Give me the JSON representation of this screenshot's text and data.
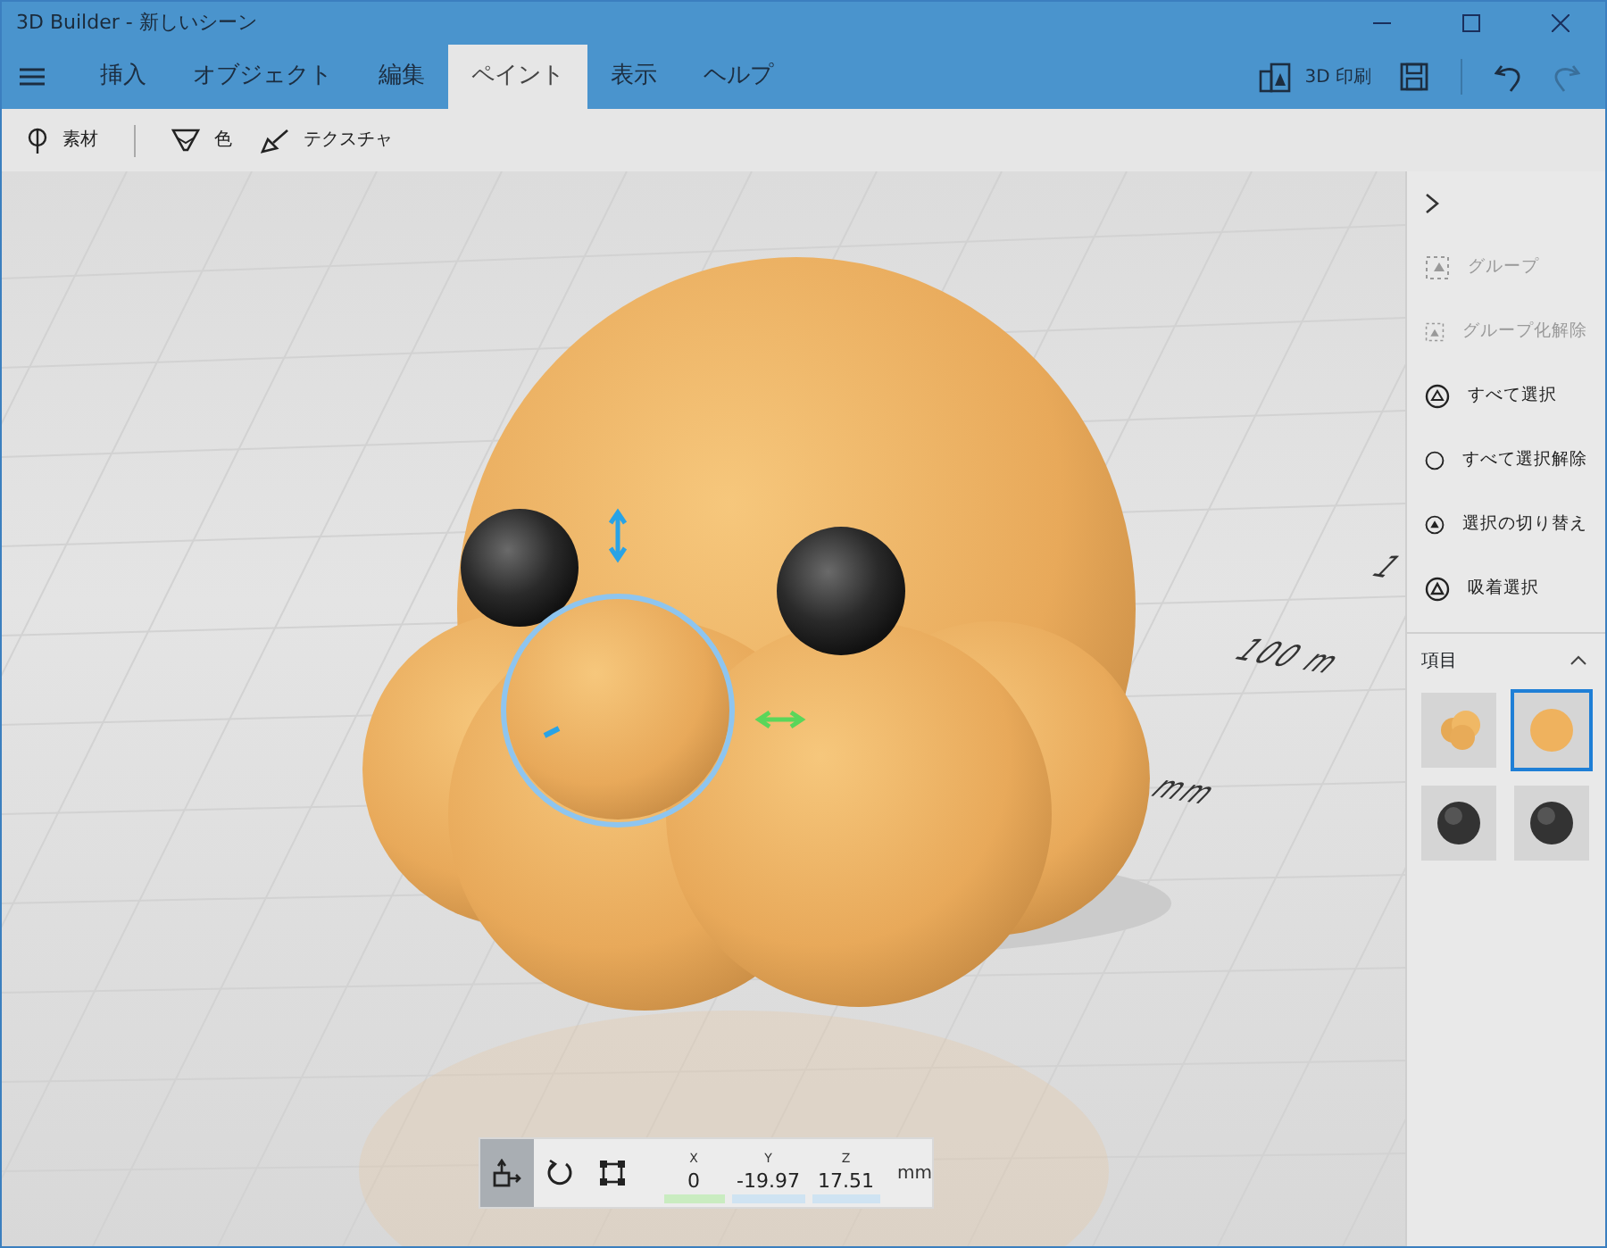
{
  "window": {
    "title": "3D Builder - 新しいシーン"
  },
  "menu_tabs": [
    {
      "label": "挿入",
      "selected": false
    },
    {
      "label": "オブジェクト",
      "selected": false
    },
    {
      "label": "編集",
      "selected": false
    },
    {
      "label": "ペイント",
      "selected": true
    },
    {
      "label": "表示",
      "selected": false
    },
    {
      "label": "ヘルプ",
      "selected": false
    }
  ],
  "header_buttons": [
    {
      "kind": "print",
      "label": "3D 印刷",
      "disabled": false
    },
    {
      "kind": "save",
      "disabled": false
    },
    {
      "kind": "undo",
      "disabled": false
    },
    {
      "kind": "redo",
      "disabled": true
    }
  ],
  "toolbar": [
    {
      "kind": "material",
      "label": "素材"
    },
    {
      "kind": "color",
      "label": "色"
    },
    {
      "kind": "texture",
      "label": "テクスチャ"
    }
  ],
  "viewport": {
    "scale_labels": [
      "1",
      "100 m",
      "mm"
    ]
  },
  "transform_bar": {
    "modes": [
      {
        "kind": "move",
        "selected": true
      },
      {
        "kind": "rotate",
        "selected": false
      },
      {
        "kind": "scale",
        "selected": false
      }
    ],
    "coords": [
      {
        "axis": "X",
        "value": "0",
        "color": "#c9ecc0"
      },
      {
        "axis": "Y",
        "value": "-19.97",
        "color": "#cfe3f2"
      },
      {
        "axis": "Z",
        "value": "17.51",
        "color": "#cfe3f2"
      }
    ],
    "unit": "mm"
  },
  "side_panel": {
    "actions": [
      {
        "kind": "group",
        "label": "グループ",
        "disabled": true
      },
      {
        "kind": "ungroup",
        "label": "グループ化解除",
        "disabled": true
      },
      {
        "kind": "select-all",
        "label": "すべて選択",
        "disabled": false
      },
      {
        "kind": "deselect",
        "label": "すべて選択解除",
        "disabled": false
      },
      {
        "kind": "toggle",
        "label": "選択の切り替え",
        "disabled": false
      },
      {
        "kind": "snap",
        "label": "吸着選択",
        "disabled": false
      }
    ],
    "items_section": {
      "title": "項目",
      "expanded": true,
      "items": [
        {
          "kind": "cluster",
          "selected": false
        },
        {
          "kind": "orange-sphere",
          "selected": true
        },
        {
          "kind": "dark-sphere",
          "selected": false
        },
        {
          "kind": "dark-sphere",
          "selected": false
        }
      ]
    }
  }
}
